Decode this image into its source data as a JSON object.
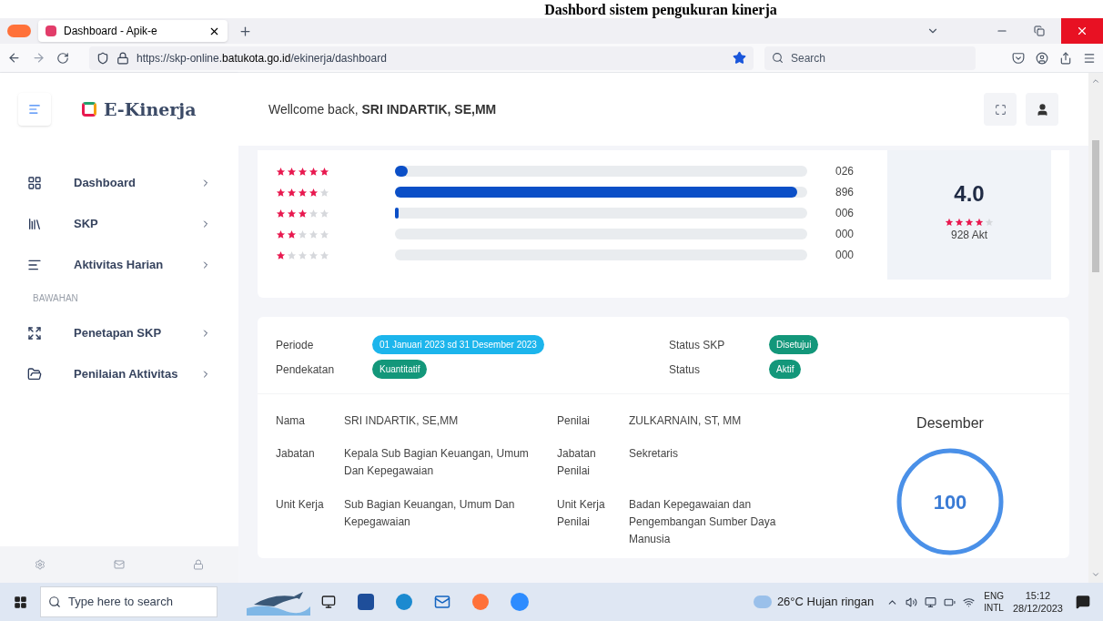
{
  "caption": "Dashbord sistem pengukuran kinerja",
  "browser": {
    "tab": {
      "title": "Dashboard - Apik-e",
      "selected": true
    },
    "url_prefix": "https://skp-online.",
    "url_domain": "batukota.go.id",
    "url_path": "/ekinerja/dashboard",
    "search_placeholder": "Search",
    "bookmarked": true
  },
  "sidebar": {
    "brand": "E-Kinerja",
    "items": [
      {
        "label": "Dashboard"
      },
      {
        "label": "SKP"
      },
      {
        "label": "Aktivitas Harian"
      }
    ],
    "section": "BAWAHAN",
    "items2": [
      {
        "label": "Penetapan SKP"
      },
      {
        "label": "Penilaian Aktivitas"
      }
    ]
  },
  "header": {
    "greeting": "Wellcome back, ",
    "user": "SRI INDARTIK, SE,MM"
  },
  "ratings": [
    {
      "stars": 5,
      "level": 0.03,
      "count": "026"
    },
    {
      "stars": 4,
      "level": 0.975,
      "count": "896"
    },
    {
      "stars": 3,
      "level": 0.008,
      "count": "006"
    },
    {
      "stars": 2,
      "level": 0,
      "count": "000"
    },
    {
      "stars": 1,
      "level": 0,
      "count": "000"
    }
  ],
  "summary": {
    "score": "4.0",
    "stars": 4,
    "total": "928 Akt"
  },
  "status": [
    {
      "label": "Periode",
      "value": "01 Januari 2023 sd 31 Desember 2023",
      "color": "#1cb5ec"
    },
    {
      "label": "Status SKP",
      "value": "Disetujui",
      "color": "#13977a"
    },
    {
      "label": "Pendekatan",
      "value": "Kuantitatif",
      "color": "#13977a"
    },
    {
      "label": "Status",
      "value": "Aktif",
      "color": "#13977a"
    }
  ],
  "details": [
    {
      "label": "Nama",
      "value": "SRI INDARTIK, SE,MM"
    },
    {
      "label": "Penilai",
      "value": "ZULKARNAIN, ST, MM"
    },
    {
      "label": "Jabatan",
      "value": "Kepala Sub Bagian Keuangan, Umum Dan Kepegawaian"
    },
    {
      "label": "Jabatan Penilai",
      "value": "Sekretaris"
    },
    {
      "label": "Unit Kerja",
      "value": "Sub Bagian Keuangan, Umum Dan Kepegawaian"
    },
    {
      "label": "Unit Kerja Penilai",
      "value": "Badan Kepegawaian dan Pengembangan Sumber Daya Manusia"
    }
  ],
  "gauge": {
    "month": "Desember",
    "value": "100"
  },
  "taskbar": {
    "search_placeholder": "Type here to search",
    "weather": "26°C Hujan ringan",
    "lang1": "ENG",
    "lang2": "INTL",
    "time": "15:12",
    "date": "28/12/2023"
  }
}
